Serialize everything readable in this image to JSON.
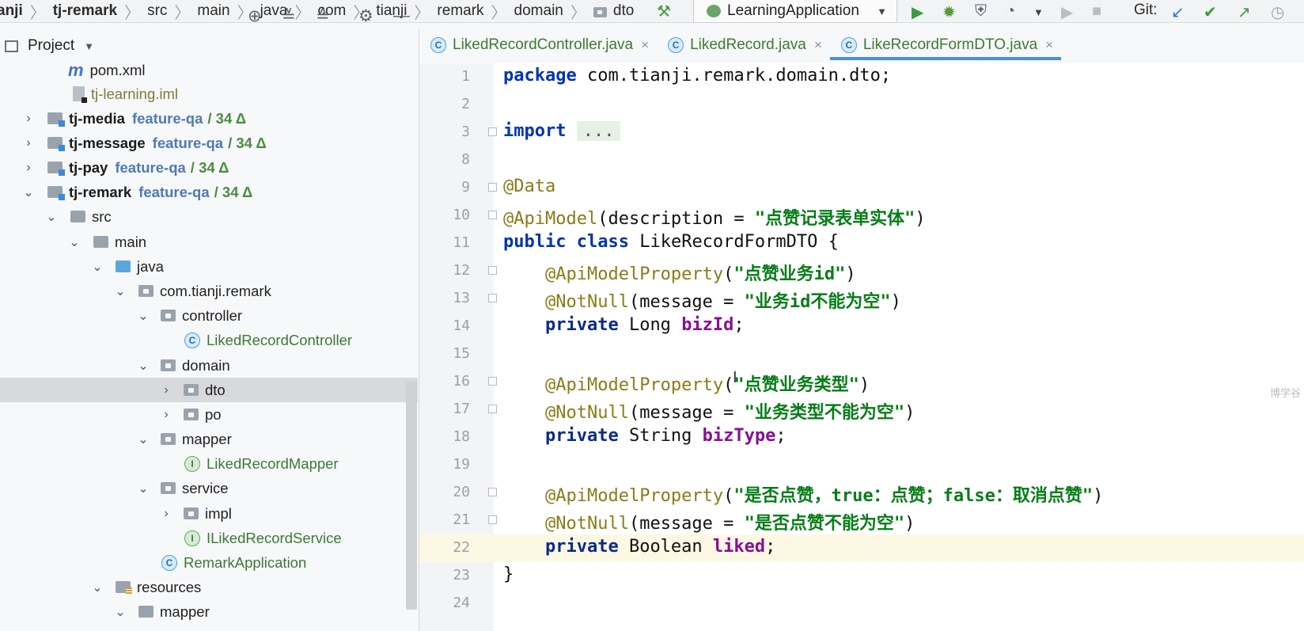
{
  "navbar": {
    "breadcrumb": [
      "anji",
      "tj-remark",
      "src",
      "main",
      "java",
      "com",
      "tianji",
      "remark",
      "domain",
      "dto"
    ],
    "run_config": "LearningApplication",
    "git_label": "Git:"
  },
  "project_panel": {
    "title": "Project",
    "rows": [
      {
        "label": "pom.xml"
      },
      {
        "label": "tj-learning.iml"
      },
      {
        "label": "tj-media",
        "branch": "feature-qa",
        "delta": "/ 34 Δ"
      },
      {
        "label": "tj-message",
        "branch": "feature-qa",
        "delta": "/ 34 Δ"
      },
      {
        "label": "tj-pay",
        "branch": "feature-qa",
        "delta": "/ 34 Δ"
      },
      {
        "label": "tj-remark",
        "branch": "feature-qa",
        "delta": "/ 34 Δ"
      },
      {
        "label": "src"
      },
      {
        "label": "main"
      },
      {
        "label": "java"
      },
      {
        "label": "com.tianji.remark"
      },
      {
        "label": "controller"
      },
      {
        "label": "LikedRecordController"
      },
      {
        "label": "domain"
      },
      {
        "label": "dto"
      },
      {
        "label": "po"
      },
      {
        "label": "mapper"
      },
      {
        "label": "LikedRecordMapper"
      },
      {
        "label": "service"
      },
      {
        "label": "impl"
      },
      {
        "label": "ILikedRecordService"
      },
      {
        "label": "RemarkApplication"
      },
      {
        "label": "resources"
      },
      {
        "label": "mapper"
      }
    ]
  },
  "tabs": [
    {
      "label": "LikedRecordController.java",
      "close": "×"
    },
    {
      "label": "LikedRecord.java",
      "close": "×"
    },
    {
      "label": "LikeRecordFormDTO.java",
      "close": "×"
    }
  ],
  "editor": {
    "line_numbers": [
      "1",
      "2",
      "3",
      "8",
      "9",
      "10",
      "11",
      "12",
      "13",
      "14",
      "15",
      "16",
      "17",
      "18",
      "19",
      "20",
      "21",
      "22",
      "23",
      "24"
    ],
    "tokens": {
      "package_kw": "package",
      "package_name": " com.tianji.remark.domain.dto;",
      "import_kw": "import",
      "import_dots": "...",
      "data_ann": "@Data",
      "apimodel_ann": "@ApiModel",
      "apimodel_open": "(description = ",
      "apimodel_str": "\"点赞记录表单实体\"",
      "close_paren": ")",
      "public_kw": "public",
      "class_kw": " class",
      "class_name": " LikeRecordFormDTO {",
      "prop_ann": "@ApiModelProperty",
      "notnull_ann": "@NotNull",
      "msg_open": "(message = ",
      "open_paren": "(",
      "private_kw": "private",
      "str_bizid_desc": "\"点赞业务id\"",
      "str_bizid_msg": "\"业务id不能为空\"",
      "type_long": " Long ",
      "field_bizid": "bizId",
      "semicolon": ";",
      "str_biztype_desc": "\"点赞业务类型\"",
      "str_biztype_msg": "\"业务类型不能为空\"",
      "type_string": " String ",
      "field_biztype": "bizType",
      "str_liked_desc": "\"是否点赞，true：点赞；false：取消点赞\"",
      "str_liked_msg": "\"是否点赞不能为空\"",
      "type_boolean": " Boolean ",
      "field_liked": "liked",
      "close_brace": "}"
    },
    "watermark": "博学谷"
  }
}
